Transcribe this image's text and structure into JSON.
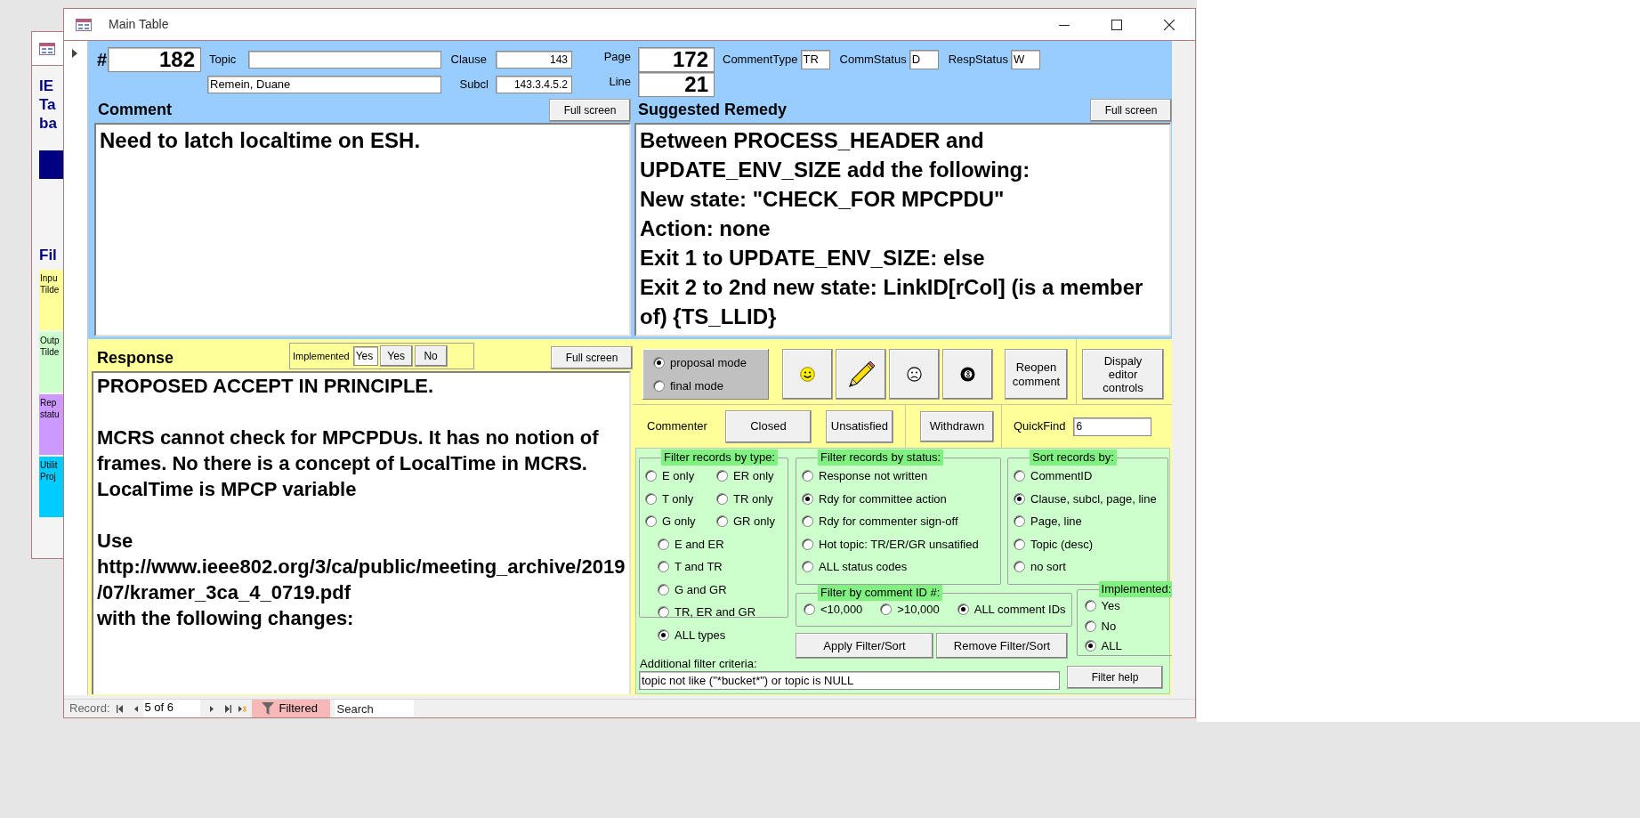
{
  "background_window": {
    "heading_lines": [
      "IE",
      "Ta",
      "ba"
    ],
    "section_heading": "Fil",
    "tiles": [
      {
        "lines": [
          "Inpu",
          "Tilde"
        ],
        "color": "#ffff99"
      },
      {
        "lines": [
          "Outp",
          "Tilde"
        ],
        "color": "#ccffcc"
      },
      {
        "lines": [
          "Rep",
          "statu"
        ],
        "color": "#cc99ff"
      },
      {
        "lines": [
          "Utilit",
          "Proj"
        ],
        "color": "#00ccff"
      }
    ]
  },
  "window": {
    "title": "Main Table"
  },
  "header": {
    "number_label": "#",
    "number": "182",
    "topic_label": "Topic",
    "commenter": "Remein, Duane",
    "clause_label": "Clause",
    "clause": "143",
    "subclause_label": "Subcl",
    "subclause": "143.3.4.5.2",
    "page_label": "Page",
    "page": "172",
    "line_label": "Line",
    "line": "21",
    "codes": [
      {
        "label": "CommentType",
        "value": "TR"
      },
      {
        "label": "CommStatus",
        "value": "D"
      },
      {
        "label": "RespStatus",
        "value": "W"
      }
    ]
  },
  "comment": {
    "heading": "Comment",
    "button": "Full screen",
    "text": "Need to latch localtime on ESH."
  },
  "suggested_remedy": {
    "heading": "Suggested Remedy",
    "button": "Full screen",
    "text": "Between PROCESS_HEADER and UPDATE_ENV_SIZE add the following:\nNew state: \"CHECK_FOR MPCPDU\"\nAction: none\nExit 1 to UPDATE_ENV_SIZE: else\nExit 2 to 2nd new state: LinkID[rCol] (is a member of) {TS_LLID}"
  },
  "response": {
    "heading": "Response",
    "implemented": {
      "label": "Implemented",
      "value": "Yes",
      "buttons": [
        "Yes",
        "No"
      ]
    },
    "button": "Full screen",
    "text": "PROPOSED ACCEPT IN PRINCIPLE.\n\nMCRS cannot check for MPCPDUs. It has no notion of frames. No there is a concept of LocalTime in MCRS. LocalTime is MPCP variable\n\nUse\nhttp://www.ieee802.org/3/ca/public/meeting_archive/2019/07/kramer_3ca_4_0719.pdf\nwith the following changes:"
  },
  "mode": [
    {
      "label": "proposal mode",
      "selected": true
    },
    {
      "label": "final mode",
      "selected": false
    }
  ],
  "action_buttons": [
    {
      "kind": "smiley"
    },
    {
      "kind": "pencil"
    },
    {
      "kind": "frown"
    },
    {
      "kind": "ball"
    },
    {
      "kind": "text",
      "label": "Reopen comment"
    },
    {
      "kind": "text",
      "label": "Dispaly editor controls"
    }
  ],
  "commenter": {
    "label": "Commenter",
    "buttons": [
      "Closed",
      "Unsatisfied"
    ]
  },
  "withdrawn_button": "Withdrawn",
  "quickfind": {
    "label": "QuickFind",
    "value": "6"
  },
  "filter_by_type": {
    "legend": "Filter records by type:",
    "options": [
      {
        "label": "E only",
        "selected": false
      },
      {
        "label": "ER only",
        "selected": false
      },
      {
        "label": "T only",
        "selected": false
      },
      {
        "label": "TR only",
        "selected": false
      },
      {
        "label": "G only",
        "selected": false
      },
      {
        "label": "GR only",
        "selected": false
      },
      {
        "label": "E and ER",
        "selected": false
      },
      {
        "label": "T and TR",
        "selected": false
      },
      {
        "label": "G and GR",
        "selected": false
      },
      {
        "label": "TR, ER and GR",
        "selected": false
      },
      {
        "label": "ALL types",
        "selected": true
      }
    ]
  },
  "filter_by_status": {
    "legend": "Filter records by status:",
    "options": [
      {
        "label": "Response not written",
        "selected": false
      },
      {
        "label": "Rdy for committee action",
        "selected": true
      },
      {
        "label": "Rdy for commenter sign-off",
        "selected": false
      },
      {
        "label": "Hot topic: TR/ER/GR unsatified",
        "selected": false
      },
      {
        "label": "ALL status codes",
        "selected": false
      }
    ]
  },
  "sort_by": {
    "legend": "Sort records by:",
    "options": [
      {
        "label": "CommentID",
        "selected": false
      },
      {
        "label": "Clause, subcl, page, line",
        "selected": true
      },
      {
        "label": "Page, line",
        "selected": false
      },
      {
        "label": "Topic (desc)",
        "selected": false
      },
      {
        "label": "no sort",
        "selected": false
      }
    ]
  },
  "filter_by_id": {
    "legend": "Filter by comment ID #:",
    "options": [
      {
        "label": "<10,000",
        "selected": false
      },
      {
        "label": ">10,000",
        "selected": false
      },
      {
        "label": "ALL comment IDs",
        "selected": true
      }
    ]
  },
  "implemented_filter": {
    "legend": "Implemented:",
    "options": [
      {
        "label": "Yes",
        "selected": false
      },
      {
        "label": "No",
        "selected": false
      },
      {
        "label": "ALL",
        "selected": true
      }
    ]
  },
  "filter_buttons": [
    "Apply Filter/Sort",
    "Remove Filter/Sort"
  ],
  "additional_filter": {
    "label": "Additional filter criteria:",
    "value": "topic not like (\"*bucket*\") or topic is NULL"
  },
  "filter_help_button": "Filter help",
  "record_nav": {
    "label": "Record:",
    "position": "5 of 6",
    "filter": "Filtered",
    "search": {
      "placeholder": "Search"
    }
  }
}
